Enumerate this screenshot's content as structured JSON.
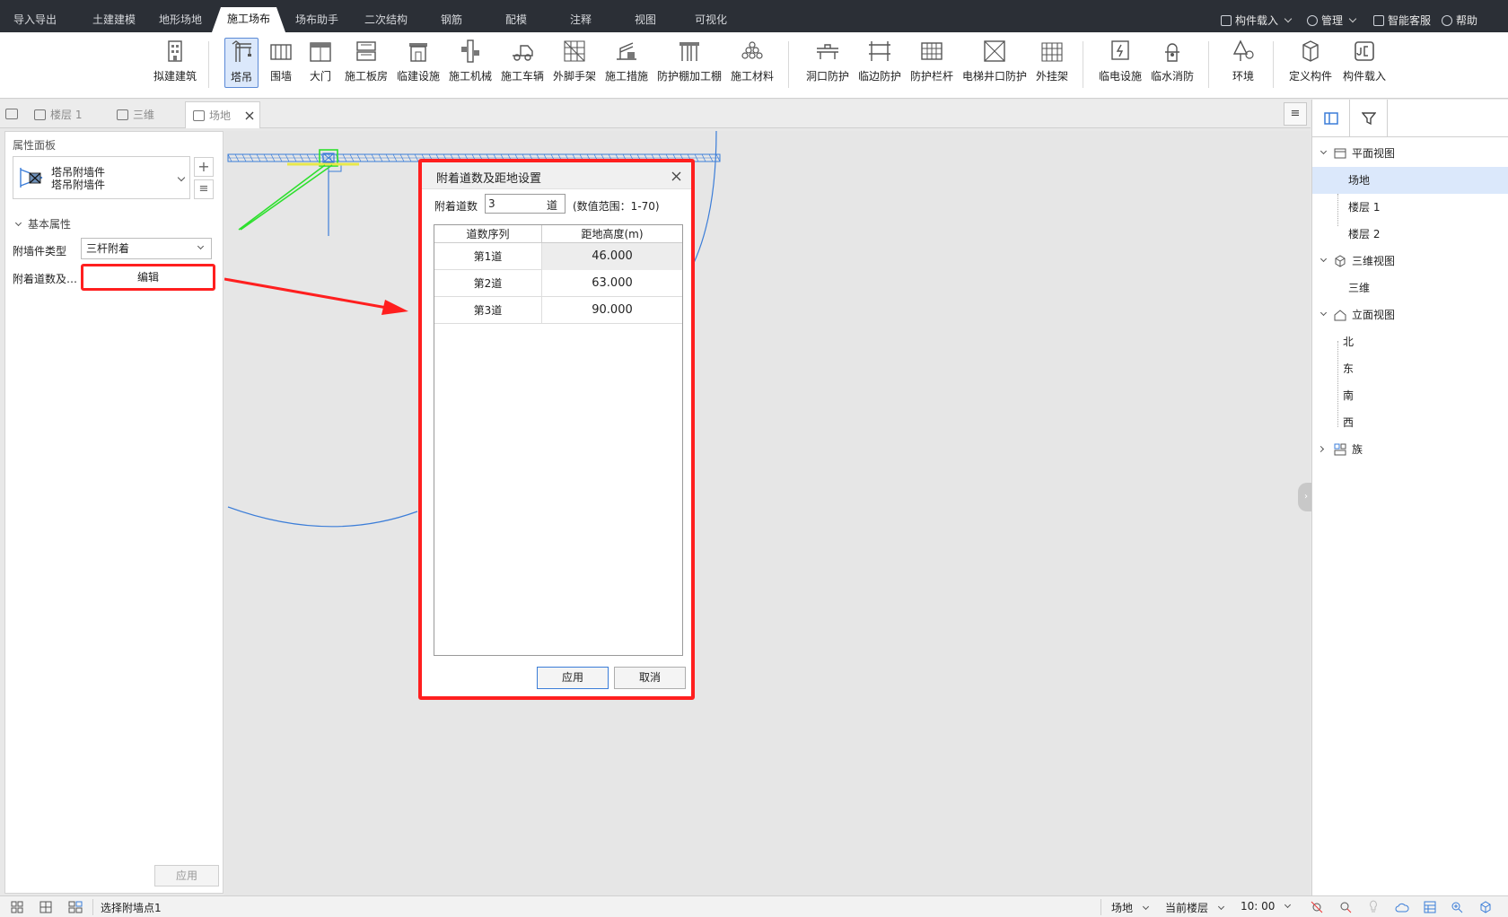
{
  "menubar": {
    "tabs": [
      "导入导出",
      "土建建模",
      "地形场地",
      "施工场布",
      "场布助手",
      "二次结构",
      "钢筋",
      "配模",
      "注释",
      "视图",
      "可视化"
    ],
    "active_tab": "施工场布",
    "right": {
      "component_load": "构件载入",
      "manage": "管理",
      "smart_service": "智能客服",
      "help": "帮助"
    }
  },
  "ribbon": {
    "groups": [
      [
        "拟建建筑"
      ],
      [
        "塔吊",
        "围墙",
        "大门",
        "施工板房",
        "临建设施",
        "施工机械",
        "施工车辆",
        "外脚手架",
        "施工措施",
        "防护棚加工棚",
        "施工材料"
      ],
      [
        "洞口防护",
        "临边防护",
        "防护栏杆",
        "电梯井口防护",
        "外挂架"
      ],
      [
        "临电设施",
        "临水消防"
      ],
      [
        "环境"
      ],
      [
        "定义构件",
        "构件载入"
      ]
    ],
    "active": "塔吊"
  },
  "doc_tabs": [
    {
      "label": "楼层 1"
    },
    {
      "label": "三维"
    },
    {
      "label": "场地"
    }
  ],
  "left_panel": {
    "title": "属性面板",
    "component": {
      "line1": "塔吊附墙件",
      "line2": "塔吊附墙件"
    },
    "section": "基本属性",
    "props": [
      {
        "label": "附墙件类型",
        "value": "三杆附着"
      },
      {
        "label": "附着道数及…",
        "value": "编辑"
      }
    ],
    "apply": "应用"
  },
  "dialog": {
    "title": "附着道数及距地设置",
    "count_label": "附着道数",
    "count_value": "3",
    "count_unit": "道",
    "range_hint": "(数值范围：1-70)",
    "headers": [
      "道数序列",
      "距地高度(m)"
    ],
    "rows": [
      {
        "seq": "第1道",
        "height": "46.000"
      },
      {
        "seq": "第2道",
        "height": "63.000"
      },
      {
        "seq": "第3道",
        "height": "90.000"
      }
    ],
    "apply": "应用",
    "cancel": "取消"
  },
  "right_panel": {
    "tree": [
      {
        "label": "平面视图",
        "level": 0,
        "expanded": true
      },
      {
        "label": "场地",
        "level": 1,
        "selected": true
      },
      {
        "label": "楼层 1",
        "level": 1
      },
      {
        "label": "楼层 2",
        "level": 1
      },
      {
        "label": "三维视图",
        "level": 0,
        "expanded": true
      },
      {
        "label": "三维",
        "level": 1
      },
      {
        "label": "立面视图",
        "level": 0,
        "expanded": true
      },
      {
        "label": "北",
        "level": 1
      },
      {
        "label": "东",
        "level": 1
      },
      {
        "label": "南",
        "level": 1
      },
      {
        "label": "西",
        "level": 1
      },
      {
        "label": "族",
        "level": 0,
        "expanded": false
      }
    ]
  },
  "status": {
    "prompt": "选择附墙点1",
    "view": "场地",
    "floor": "当前楼层",
    "scale": "10: 00"
  },
  "colors": {
    "highlight": "#ff1f1f",
    "accent": "#3b7dd8",
    "menubar": "#2b2f36"
  }
}
